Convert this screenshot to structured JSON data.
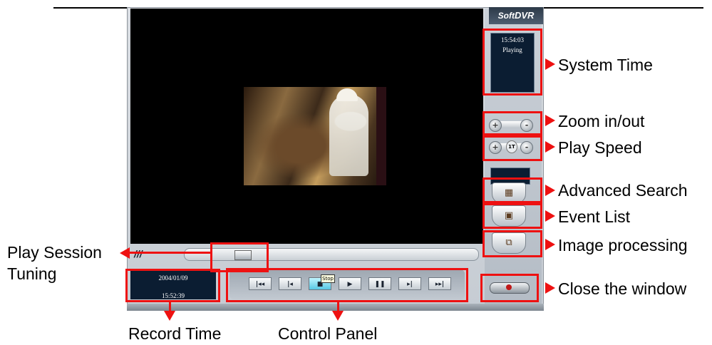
{
  "app": {
    "logo_soft": "Soft",
    "logo_dvr": "DVR"
  },
  "system_panel": {
    "time": "15:54:03",
    "status": "Playing"
  },
  "record_panel": {
    "date": "2004/01/09",
    "time": "15:52:39"
  },
  "seek": {
    "left_mark": "///",
    "position": 0.2
  },
  "zoom": {
    "minus": "-",
    "plus": "+"
  },
  "speed": {
    "minus": "-",
    "plus": "+",
    "value": "1T"
  },
  "controls": {
    "buttons": [
      {
        "name": "first-button",
        "icon": "first-icon",
        "glyph": "|◂◂"
      },
      {
        "name": "prev-button",
        "icon": "prev-icon",
        "glyph": "|◂"
      },
      {
        "name": "stop-button",
        "icon": "stop-icon",
        "glyph": "■"
      },
      {
        "name": "play-button",
        "icon": "play-icon",
        "glyph": "▶"
      },
      {
        "name": "pause-button",
        "icon": "pause-icon",
        "glyph": "❚❚"
      },
      {
        "name": "next-button",
        "icon": "next-icon",
        "glyph": "▸|"
      },
      {
        "name": "last-button",
        "icon": "last-icon",
        "glyph": "▸▸|"
      }
    ],
    "tooltip": "Stop"
  },
  "side_buttons": {
    "search_icon": "search-icon",
    "event_icon": "event-list-icon",
    "image_icon": "image-processing-icon"
  },
  "callouts": {
    "system_time": "System Time",
    "zoom": "Zoom in/out",
    "play_speed": "Play Speed",
    "advanced_search": "Advanced Search",
    "event_list": "Event List",
    "image_processing": "Image processing",
    "close_window": "Close the window",
    "play_session_line1": "Play Session",
    "play_session_line2": "Tuning",
    "record_time": "Record Time",
    "control_panel": "Control Panel"
  },
  "colors": {
    "callout_red": "#ee1111",
    "panel_navy": "#0b1d32",
    "active_button": "#57c7e4"
  }
}
